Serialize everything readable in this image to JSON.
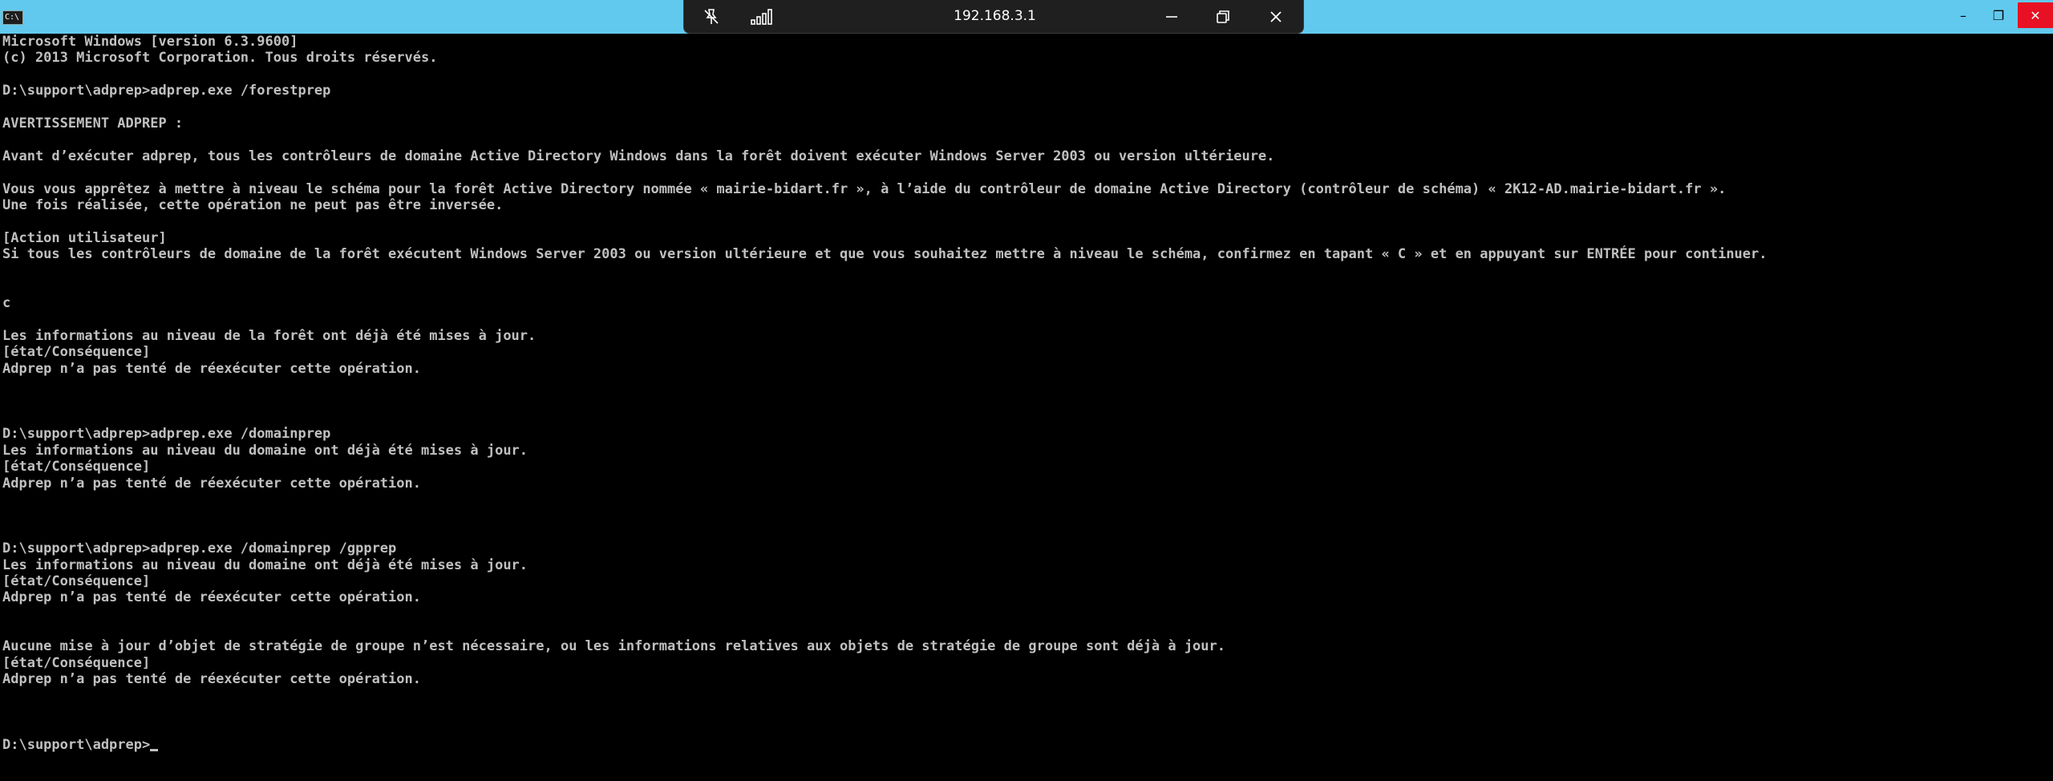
{
  "window": {
    "icon_label": "C:\\",
    "minimize_glyph": "–",
    "restore_glyph": "❐",
    "close_glyph": "✕"
  },
  "rdp": {
    "host": "192.168.3.1",
    "minimize_glyph": "—",
    "close_glyph": "✕"
  },
  "console": {
    "lines": [
      "Microsoft Windows [version 6.3.9600]",
      "(c) 2013 Microsoft Corporation. Tous droits réservés.",
      "",
      "D:\\support\\adprep>adprep.exe /forestprep",
      "",
      "AVERTISSEMENT ADPREP :",
      "",
      "Avant d’exécuter adprep, tous les contrôleurs de domaine Active Directory Windows dans la forêt doivent exécuter Windows Server 2003 ou version ultérieure.",
      "",
      "Vous vous apprêtez à mettre à niveau le schéma pour la forêt Active Directory nommée « mairie-bidart.fr », à l’aide du contrôleur de domaine Active Directory (contrôleur de schéma) « 2K12-AD.mairie-bidart.fr ».",
      "Une fois réalisée, cette opération ne peut pas être inversée.",
      "",
      "[Action utilisateur]",
      "Si tous les contrôleurs de domaine de la forêt exécutent Windows Server 2003 ou version ultérieure et que vous souhaitez mettre à niveau le schéma, confirmez en tapant « C » et en appuyant sur ENTRÉE pour continuer.",
      "",
      "",
      "c",
      "",
      "Les informations au niveau de la forêt ont déjà été mises à jour.",
      "[état/Conséquence]",
      "Adprep n’a pas tenté de réexécuter cette opération.",
      "",
      "",
      "",
      "D:\\support\\adprep>adprep.exe /domainprep",
      "Les informations au niveau du domaine ont déjà été mises à jour.",
      "[état/Conséquence]",
      "Adprep n’a pas tenté de réexécuter cette opération.",
      "",
      "",
      "",
      "D:\\support\\adprep>adprep.exe /domainprep /gpprep",
      "Les informations au niveau du domaine ont déjà été mises à jour.",
      "[état/Conséquence]",
      "Adprep n’a pas tenté de réexécuter cette opération.",
      "",
      "",
      "Aucune mise à jour d’objet de stratégie de groupe n’est nécessaire, ou les informations relatives aux objets de stratégie de groupe sont déjà à jour.",
      "[état/Conséquence]",
      "Adprep n’a pas tenté de réexécuter cette opération.",
      "",
      "",
      "",
      "D:\\support\\adprep>"
    ]
  }
}
